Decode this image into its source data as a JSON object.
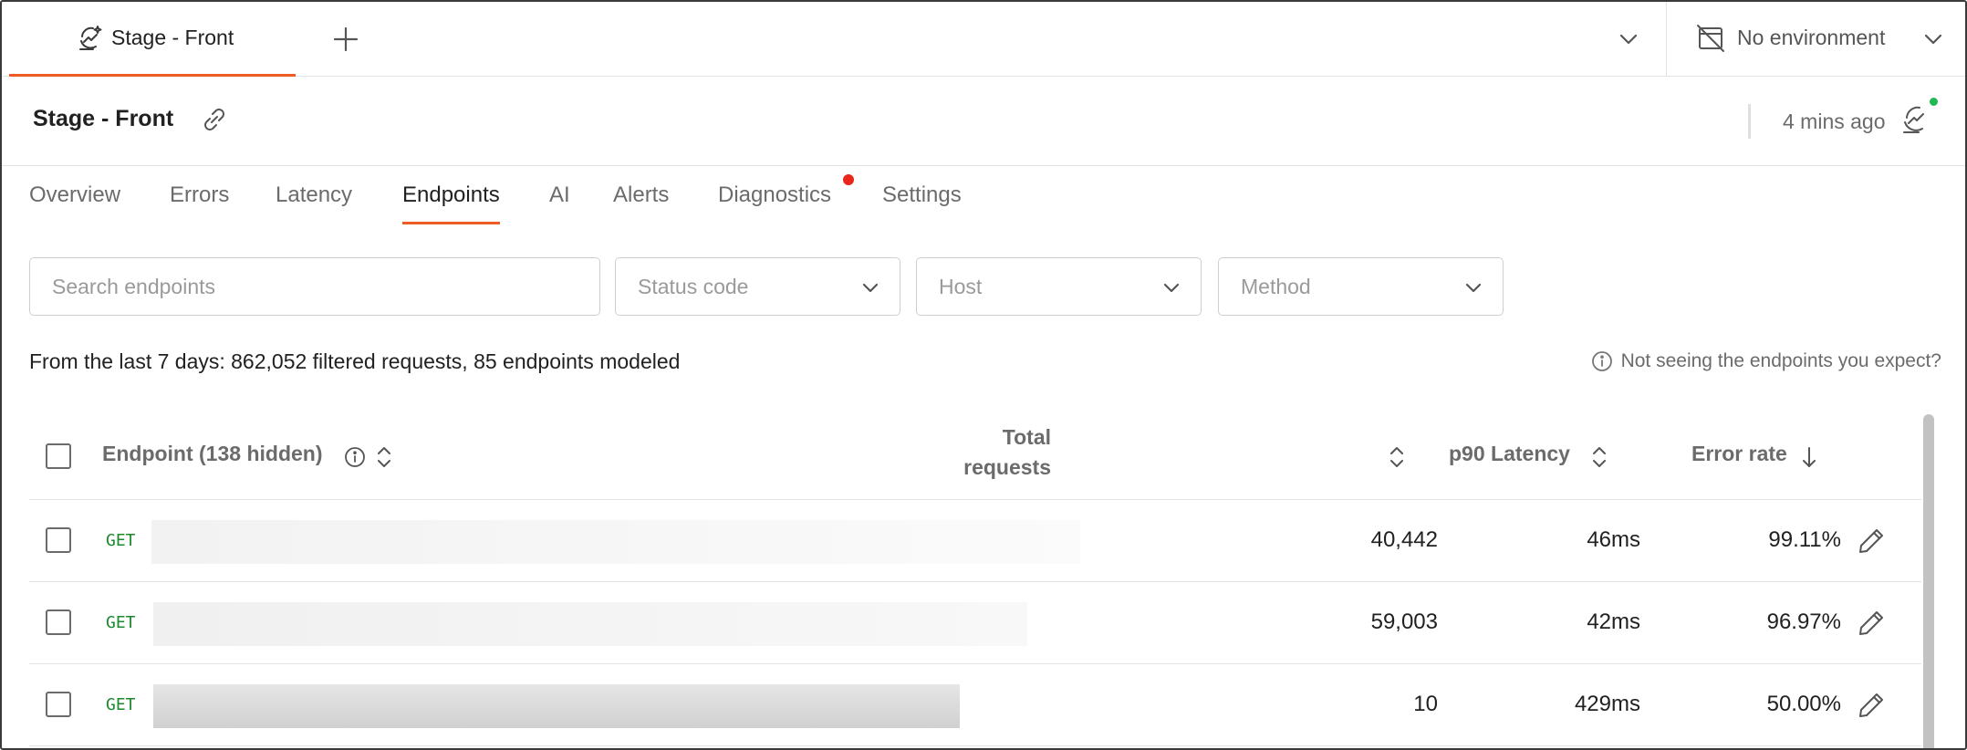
{
  "tabs": {
    "active_label": "Stage - Front",
    "environment": "No environment"
  },
  "header": {
    "title": "Stage - Front",
    "updated": "4 mins ago"
  },
  "nav": [
    {
      "label": "Overview"
    },
    {
      "label": "Errors"
    },
    {
      "label": "Latency"
    },
    {
      "label": "Endpoints"
    },
    {
      "label": "AI"
    },
    {
      "label": "Alerts"
    },
    {
      "label": "Diagnostics"
    },
    {
      "label": "Settings"
    }
  ],
  "filters": {
    "search_placeholder": "Search endpoints",
    "status_code": "Status code",
    "host": "Host",
    "method": "Method"
  },
  "summary": "From the last 7 days: 862,052 filtered requests, 85 endpoints modeled",
  "help_text": "Not seeing the endpoints you expect?",
  "table": {
    "columns": {
      "endpoint": "Endpoint (138 hidden)",
      "total_line1": "Total",
      "total_line2": "requests",
      "latency": "p90 Latency",
      "error_rate": "Error rate"
    },
    "rows": [
      {
        "method": "GET",
        "total": "40,442",
        "latency": "46ms",
        "error_rate": "99.11%"
      },
      {
        "method": "GET",
        "total": "59,003",
        "latency": "42ms",
        "error_rate": "96.97%"
      },
      {
        "method": "GET",
        "total": "10",
        "latency": "429ms",
        "error_rate": "50.00%"
      }
    ]
  },
  "colors": {
    "accent": "#ef5b25",
    "get_method": "#1a8a2d",
    "notification": "#e8261b",
    "online": "#1db954"
  }
}
